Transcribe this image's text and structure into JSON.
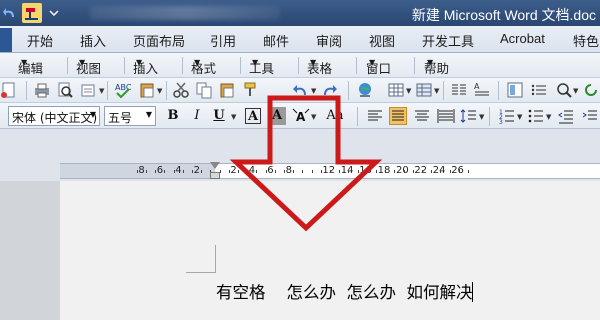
{
  "window": {
    "title": "新建 Microsoft Word 文档.doc"
  },
  "quick_access": [
    "undo-icon",
    "format-painter-icon",
    "customize-icon"
  ],
  "tabs": [
    {
      "label": "开始"
    },
    {
      "label": "插入"
    },
    {
      "label": "页面布局"
    },
    {
      "label": "引用"
    },
    {
      "label": "邮件"
    },
    {
      "label": "审阅"
    },
    {
      "label": "视图"
    },
    {
      "label": "开发工具"
    },
    {
      "label": "Acrobat"
    },
    {
      "label": "特色"
    }
  ],
  "menus": [
    {
      "label": "编辑"
    },
    {
      "label": "视图"
    },
    {
      "label": "插入"
    },
    {
      "label": "格式"
    },
    {
      "label": "工具"
    },
    {
      "label": "表格"
    },
    {
      "label": "窗口"
    },
    {
      "label": "帮助"
    }
  ],
  "format": {
    "font_name": "宋体 (中文正文)",
    "font_size": "五号",
    "bold": "B",
    "italic": "I",
    "underline": "U",
    "char_border": "A",
    "char_shading": "A",
    "change_case": "Aa"
  },
  "ruler": {
    "labels": [
      "8",
      "6",
      "4",
      "2",
      "2",
      "4",
      "6",
      "8",
      "12",
      "14",
      "16",
      "18",
      "20",
      "22",
      "24",
      "26"
    ]
  },
  "document": {
    "text": "有空格    怎么办  怎么办  如何解决"
  },
  "colors": {
    "arrow": "#cc1a1a",
    "title_bar": "#2a4672"
  }
}
